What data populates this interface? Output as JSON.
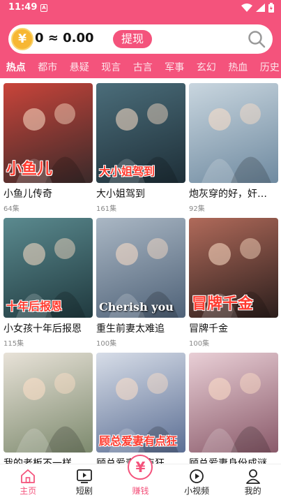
{
  "status_bar": {
    "time": "11:49",
    "notif_letter": "A"
  },
  "wallet": {
    "coin_symbol": "¥",
    "balance": "0 ≈ 0.00",
    "withdraw_label": "提现"
  },
  "categories": [
    "热点",
    "都市",
    "悬疑",
    "现言",
    "古言",
    "军事",
    "玄幻",
    "热血",
    "历史"
  ],
  "dramas": [
    {
      "title": "小鱼儿传奇",
      "episodes": "64集",
      "poster_text": "小鱼儿",
      "c1": "#c9443a",
      "c2": "#3a2a2a"
    },
    {
      "title": "大小姐驾到",
      "episodes": "161集",
      "poster_text": "大小姐驾到",
      "c1": "#4b6d7a",
      "c2": "#1e2f38"
    },
    {
      "title": "炮灰穿的好，奸…",
      "episodes": "92集",
      "poster_text": "",
      "c1": "#c9d6df",
      "c2": "#6f8aa0"
    },
    {
      "title": "小女孩十年后报恩",
      "episodes": "115集",
      "poster_text": "十年后报恩",
      "c1": "#5b8a8f",
      "c2": "#203a3f"
    },
    {
      "title": "重生前妻太难追",
      "episodes": "100集",
      "poster_text": "Cherish you",
      "c1": "#aab7c4",
      "c2": "#4f6278"
    },
    {
      "title": "冒牌千金",
      "episodes": "100集",
      "poster_text": "冒牌千金",
      "c1": "#b06a5a",
      "c2": "#2b1e1c"
    },
    {
      "title": "我的老板不一样",
      "episodes": "",
      "poster_text": "",
      "c1": "#e8e2d8",
      "c2": "#7d8a6e"
    },
    {
      "title": "顾总爱妻有点狂",
      "episodes": "",
      "poster_text": "顾总爱妻有点狂",
      "c1": "#d7dde8",
      "c2": "#5c6f94"
    },
    {
      "title": "顾总爱妻身份成谜",
      "episodes": "",
      "poster_text": "",
      "c1": "#e9cfd6",
      "c2": "#8a5a6a"
    }
  ],
  "tabs": [
    {
      "label": "主页",
      "icon": "home-icon"
    },
    {
      "label": "短剧",
      "icon": "tv-icon"
    },
    {
      "label": "赚钱",
      "icon": "yuan-icon",
      "symbol": "¥"
    },
    {
      "label": "小视频",
      "icon": "play-icon"
    },
    {
      "label": "我的",
      "icon": "user-icon"
    }
  ],
  "colors": {
    "brand": "#f4537c",
    "coin": "#f7b733"
  }
}
